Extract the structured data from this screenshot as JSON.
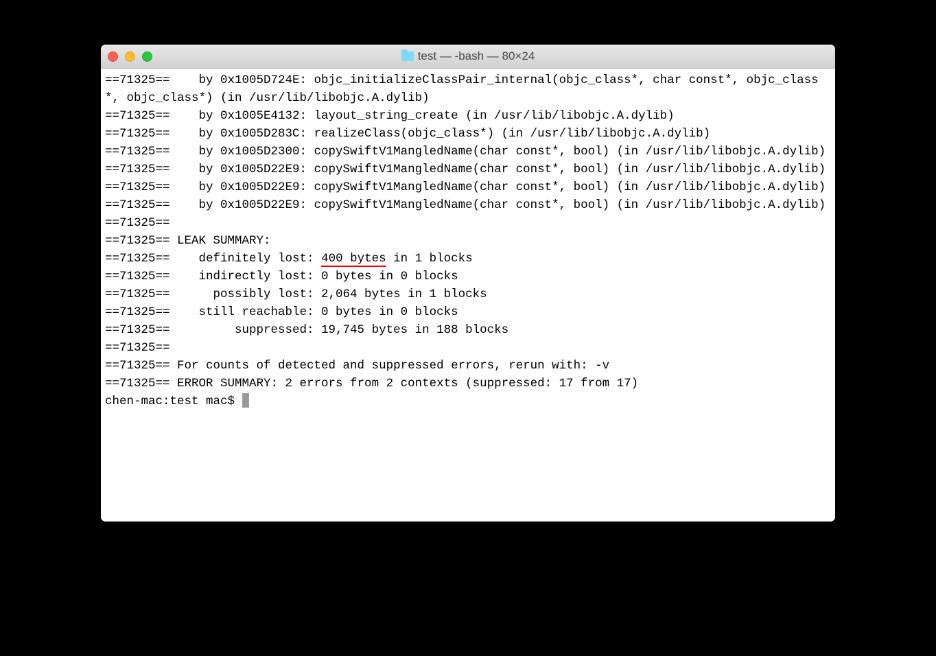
{
  "window": {
    "title": "test — -bash — 80×24"
  },
  "terminal": {
    "lines": [
      "==71325==    by 0x1005D724E: objc_initializeClassPair_internal(objc_class*, char const*, objc_class*, objc_class*) (in /usr/lib/libobjc.A.dylib)",
      "==71325==    by 0x1005E4132: layout_string_create (in /usr/lib/libobjc.A.dylib)",
      "==71325==    by 0x1005D283C: realizeClass(objc_class*) (in /usr/lib/libobjc.A.dylib)",
      "==71325==    by 0x1005D2300: copySwiftV1MangledName(char const*, bool) (in /usr/lib/libobjc.A.dylib)",
      "==71325==    by 0x1005D22E9: copySwiftV1MangledName(char const*, bool) (in /usr/lib/libobjc.A.dylib)",
      "==71325==    by 0x1005D22E9: copySwiftV1MangledName(char const*, bool) (in /usr/lib/libobjc.A.dylib)",
      "==71325==    by 0x1005D22E9: copySwiftV1MangledName(char const*, bool) (in /usr/lib/libobjc.A.dylib)",
      "==71325== ",
      "==71325== LEAK SUMMARY:"
    ],
    "leak_line_prefix": "==71325==    definitely lost: ",
    "leak_highlight": "400 bytes",
    "leak_line_suffix": " in 1 blocks",
    "lines_after": [
      "==71325==    indirectly lost: 0 bytes in 0 blocks",
      "==71325==      possibly lost: 2,064 bytes in 1 blocks",
      "==71325==    still reachable: 0 bytes in 0 blocks",
      "==71325==         suppressed: 19,745 bytes in 188 blocks",
      "==71325== ",
      "==71325== For counts of detected and suppressed errors, rerun with: -v",
      "==71325== ERROR SUMMARY: 2 errors from 2 contexts (suppressed: 17 from 17)"
    ],
    "prompt": "chen-mac:test mac$ "
  }
}
